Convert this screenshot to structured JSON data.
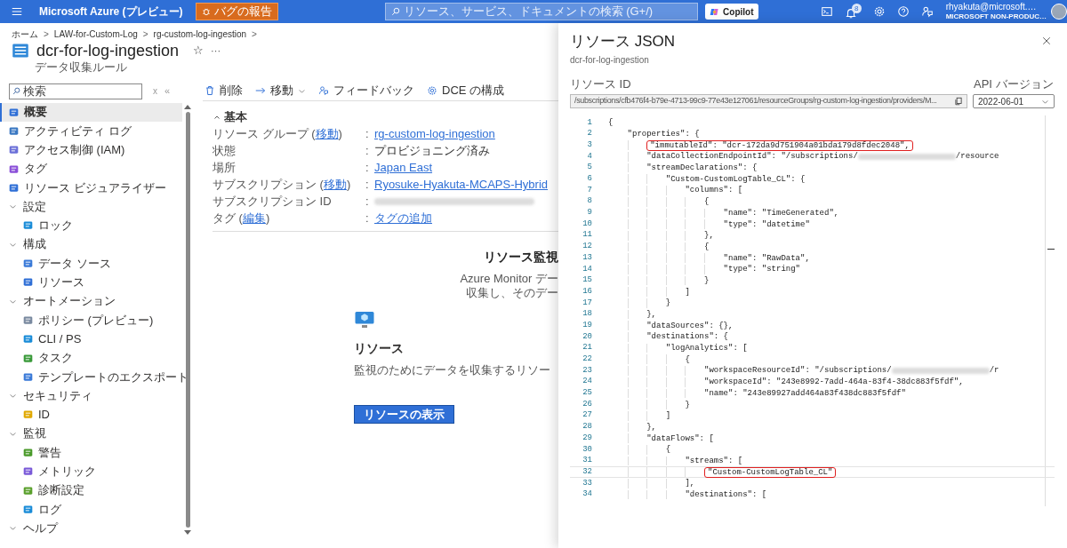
{
  "header": {
    "brand": "Microsoft Azure (プレビュー)",
    "bug_button": "バグの報告",
    "search": {
      "placeholder": "リソース、サービス、ドキュメントの検索 (G+/)"
    },
    "copilot": "Copilot",
    "notification_count": "8",
    "user": {
      "name": "rhyakuta@microsoft.…",
      "tenant": "MICROSOFT NON-PRODUC…"
    }
  },
  "breadcrumb": [
    {
      "label": "ホーム",
      "sep": ">"
    },
    {
      "label": "LAW-for-Custom-Log",
      "sep": ">"
    },
    {
      "label": "rg-custom-log-ingestion",
      "sep": ">"
    }
  ],
  "page": {
    "title": "dcr-for-log-ingestion",
    "star": "☆",
    "more": "···",
    "subtitle": "データ収集ルール"
  },
  "sidebar": {
    "search": {
      "placeholder": "検索"
    },
    "clear": "x",
    "collapse": "«",
    "items": [
      {
        "kind": "item",
        "label": "概要",
        "selected": true
      },
      {
        "kind": "item",
        "label": "アクティビティ ログ",
        "selected": false
      },
      {
        "kind": "item",
        "label": "アクセス制御 (IAM)",
        "selected": false
      },
      {
        "kind": "item",
        "label": "タグ",
        "selected": false
      },
      {
        "kind": "item",
        "label": "リソース ビジュアライザー",
        "selected": false
      },
      {
        "kind": "group",
        "label": "設定",
        "expanded": true,
        "children": [
          {
            "kind": "item",
            "label": "ロック",
            "selected": false
          }
        ]
      },
      {
        "kind": "group",
        "label": "構成",
        "expanded": true,
        "children": [
          {
            "kind": "item",
            "label": "データ ソース",
            "selected": false
          },
          {
            "kind": "item",
            "label": "リソース",
            "selected": false
          }
        ]
      },
      {
        "kind": "group",
        "label": "オートメーション",
        "expanded": true,
        "children": [
          {
            "kind": "item",
            "label": "ポリシー (プレビュー)",
            "selected": false
          },
          {
            "kind": "item",
            "label": "CLI / PS",
            "selected": false
          },
          {
            "kind": "item",
            "label": "タスク",
            "selected": false
          },
          {
            "kind": "item",
            "label": "テンプレートのエクスポート",
            "selected": false
          }
        ]
      },
      {
        "kind": "group",
        "label": "セキュリティ",
        "expanded": true,
        "children": [
          {
            "kind": "item",
            "label": "ID",
            "selected": false
          }
        ]
      },
      {
        "kind": "group",
        "label": "監視",
        "expanded": true,
        "children": [
          {
            "kind": "item",
            "label": "警告",
            "selected": false
          },
          {
            "kind": "item",
            "label": "メトリック",
            "selected": false
          },
          {
            "kind": "item",
            "label": "診断設定",
            "selected": false
          },
          {
            "kind": "item",
            "label": "ログ",
            "selected": false
          }
        ]
      },
      {
        "kind": "group",
        "label": "ヘルプ",
        "expanded": true
      }
    ]
  },
  "toolbar": [
    {
      "label": "削除",
      "dropdown": false
    },
    {
      "label": "移動",
      "dropdown": true
    },
    {
      "label": "フィードバック",
      "dropdown": false
    },
    {
      "label": "DCE の構成",
      "dropdown": false
    }
  ],
  "essentials": {
    "title": "基本",
    "expanded": true,
    "rows": [
      {
        "label": "リソース グループ (",
        "label_link": "移動",
        "label_end": ")",
        "colon": ":",
        "kind": "link",
        "value": "rg-custom-log-ingestion"
      },
      {
        "label": "状態",
        "colon": ":",
        "kind": "text",
        "value": "プロビジョニング済み"
      },
      {
        "label": "場所",
        "colon": ":",
        "kind": "link",
        "value": "Japan East"
      },
      {
        "label": "サブスクリプション (",
        "label_link": "移動",
        "label_end": ")",
        "colon": ":",
        "kind": "link",
        "value": "Ryosuke-Hyakuta-MCAPS-Hybrid"
      },
      {
        "label": "サブスクリプション ID",
        "colon": ":",
        "kind": "redacted"
      },
      {
        "label": "タグ (",
        "label_link": "編集",
        "label_end": ")",
        "colon": ":",
        "kind": "link",
        "value": "タグの追加"
      }
    ]
  },
  "monitoring": {
    "heading": "リソース監視",
    "lines": [
      "Azure Monitor デー",
      "収集し、そのデー"
    ],
    "card": {
      "title": "リソース",
      "description": "監視のためにデータを収集するリソー",
      "button": "リソースの表示"
    }
  },
  "json_panel": {
    "title": "リソース JSON",
    "subtitle": "dcr-for-log-ingestion",
    "resource_id_label": "リソース ID",
    "resource_id": "/subscriptions/cfb476f4-b79e-4713-99c9-77e43e127061/resourceGroups/rg-custom-log-ingestion/providers/M...",
    "api_label": "API バージョン",
    "api_version": "2022-06-01",
    "lines": [
      {
        "number": "1",
        "text": "{"
      },
      {
        "number": "2",
        "text": "    \"properties\": {"
      },
      {
        "number": "3",
        "text": "        \"immutableId\": \"dcr-172da9d751904a01bda179d8fdec2048\",",
        "highlight": true
      },
      {
        "number": "4",
        "text": "        \"dataCollectionEndpointId\": \"/subscriptions/",
        "redacted": true,
        "tail": "/resource"
      },
      {
        "number": "5",
        "text": "        \"streamDeclarations\": {"
      },
      {
        "number": "6",
        "text": "            \"Custom-CustomLogTable_CL\": {"
      },
      {
        "number": "7",
        "text": "                \"columns\": ["
      },
      {
        "number": "8",
        "text": "                    {"
      },
      {
        "number": "9",
        "text": "                        \"name\": \"TimeGenerated\","
      },
      {
        "number": "10",
        "text": "                        \"type\": \"datetime\""
      },
      {
        "number": "11",
        "text": "                    },"
      },
      {
        "number": "12",
        "text": "                    {"
      },
      {
        "number": "13",
        "text": "                        \"name\": \"RawData\","
      },
      {
        "number": "14",
        "text": "                        \"type\": \"string\""
      },
      {
        "number": "15",
        "text": "                    }"
      },
      {
        "number": "16",
        "text": "                ]"
      },
      {
        "number": "17",
        "text": "            }"
      },
      {
        "number": "18",
        "text": "        },"
      },
      {
        "number": "19",
        "text": "        \"dataSources\": {},"
      },
      {
        "number": "20",
        "text": "        \"destinations\": {"
      },
      {
        "number": "21",
        "text": "            \"logAnalytics\": ["
      },
      {
        "number": "22",
        "text": "                {"
      },
      {
        "number": "23",
        "text": "                    \"workspaceResourceId\": \"/subscriptions/",
        "redacted": true,
        "tail": "/r"
      },
      {
        "number": "24",
        "text": "                    \"workspaceId\": \"243e8992-7add-464a-83f4-38dc883f5fdf\","
      },
      {
        "number": "25",
        "text": "                    \"name\": \"243e89927add464a83f438dc883f5fdf\""
      },
      {
        "number": "26",
        "text": "                }"
      },
      {
        "number": "27",
        "text": "            ]"
      },
      {
        "number": "28",
        "text": "        },"
      },
      {
        "number": "29",
        "text": "        \"dataFlows\": ["
      },
      {
        "number": "30",
        "text": "            {"
      },
      {
        "number": "31",
        "text": "                \"streams\": ["
      },
      {
        "number": "32",
        "text": "                    \"Custom-CustomLogTable_CL\"",
        "highlight": true,
        "current": true
      },
      {
        "number": "33",
        "text": "                ],"
      },
      {
        "number": "34",
        "text": "                \"destinations\": ["
      }
    ]
  }
}
